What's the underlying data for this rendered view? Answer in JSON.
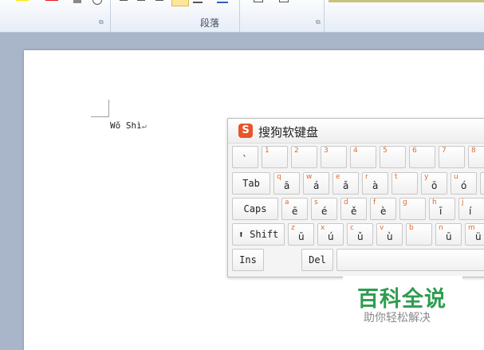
{
  "ribbon": {
    "paragraph_group_label": "段落"
  },
  "document": {
    "text": "Wǒ Shì",
    "paragraph_mark": "↵"
  },
  "keyboard": {
    "title": "搜狗软键盘",
    "logo_letter": "S",
    "rows": [
      [
        {
          "top": "",
          "main": "`"
        },
        {
          "top": "1",
          "main": ""
        },
        {
          "top": "2",
          "main": ""
        },
        {
          "top": "3",
          "main": ""
        },
        {
          "top": "4",
          "main": ""
        },
        {
          "top": "5",
          "main": ""
        },
        {
          "top": "6",
          "main": ""
        },
        {
          "top": "7",
          "main": ""
        },
        {
          "top": "8",
          "main": ""
        }
      ],
      [
        {
          "label": "Tab"
        },
        {
          "top": "q",
          "main": "ā"
        },
        {
          "top": "w",
          "main": "á"
        },
        {
          "top": "e",
          "main": "ǎ"
        },
        {
          "top": "r",
          "main": "à"
        },
        {
          "top": "t",
          "main": ""
        },
        {
          "top": "y",
          "main": "ō"
        },
        {
          "top": "u",
          "main": "ó"
        },
        {
          "top": "",
          "main": ""
        }
      ],
      [
        {
          "label": "Caps"
        },
        {
          "top": "a",
          "main": "ē"
        },
        {
          "top": "s",
          "main": "é"
        },
        {
          "top": "d",
          "main": "ě"
        },
        {
          "top": "f",
          "main": "è"
        },
        {
          "top": "g",
          "main": ""
        },
        {
          "top": "h",
          "main": "ī"
        },
        {
          "top": "j",
          "main": "í"
        }
      ],
      [
        {
          "label": "⬆ Shift"
        },
        {
          "top": "z",
          "main": "ū"
        },
        {
          "top": "x",
          "main": "ú"
        },
        {
          "top": "c",
          "main": "ǔ"
        },
        {
          "top": "v",
          "main": "ù"
        },
        {
          "top": "b",
          "main": ""
        },
        {
          "top": "n",
          "main": "ū"
        },
        {
          "top": "m",
          "main": "ü"
        }
      ],
      [
        {
          "label": "Ins"
        },
        {
          "label": "Del"
        },
        {
          "label": ""
        }
      ]
    ]
  },
  "watermark": {
    "main": "百科全说",
    "sub": "助你轻松解决"
  },
  "colors": {
    "accent_orange": "#e26a2a",
    "watermark_green": "#2e9d4f"
  }
}
